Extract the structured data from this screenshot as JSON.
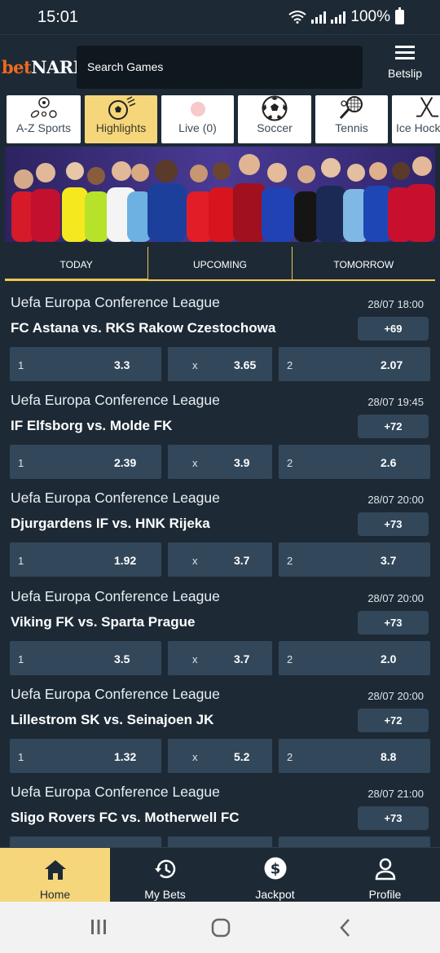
{
  "status": {
    "time": "15:01",
    "battery": "100%"
  },
  "header": {
    "logo_bet": "bet",
    "logo_nare": "NARE",
    "search_placeholder": "Search Games",
    "betslip_label": "Betslip"
  },
  "sports": [
    {
      "label": "A-Z Sports",
      "icon": "sports-balls-icon"
    },
    {
      "label": "Highlights",
      "icon": "soccer-ball-fast-icon"
    },
    {
      "label": "Live (0)",
      "icon": "live-dot-icon"
    },
    {
      "label": "Soccer",
      "icon": "soccer-ball-icon"
    },
    {
      "label": "Tennis",
      "icon": "tennis-racket-icon"
    },
    {
      "label": "Ice Hockey",
      "icon": "hockey-sticks-icon"
    }
  ],
  "tabs": [
    "TODAY",
    "UPCOMING",
    "TOMORROW"
  ],
  "matches": [
    {
      "league": "Uefa Europa Conference League",
      "time": "28/07 18:00",
      "teams": "FC Astana vs. RKS Rakow Czestochowa",
      "more": "+69",
      "odds": {
        "k1": "1",
        "v1": "3.3",
        "kx": "x",
        "vx": "3.65",
        "k2": "2",
        "v2": "2.07"
      }
    },
    {
      "league": "Uefa Europa Conference League",
      "time": "28/07 19:45",
      "teams": "IF Elfsborg vs. Molde FK",
      "more": "+72",
      "odds": {
        "k1": "1",
        "v1": "2.39",
        "kx": "x",
        "vx": "3.9",
        "k2": "2",
        "v2": "2.6"
      }
    },
    {
      "league": "Uefa Europa Conference League",
      "time": "28/07 20:00",
      "teams": "Djurgardens IF vs. HNK Rijeka",
      "more": "+73",
      "odds": {
        "k1": "1",
        "v1": "1.92",
        "kx": "x",
        "vx": "3.7",
        "k2": "2",
        "v2": "3.7"
      }
    },
    {
      "league": "Uefa Europa Conference League",
      "time": "28/07 20:00",
      "teams": "Viking FK vs. Sparta Prague",
      "more": "+73",
      "odds": {
        "k1": "1",
        "v1": "3.5",
        "kx": "x",
        "vx": "3.7",
        "k2": "2",
        "v2": "2.0"
      }
    },
    {
      "league": "Uefa Europa Conference League",
      "time": "28/07 20:00",
      "teams": "Lillestrom SK vs. Seinajoen JK",
      "more": "+72",
      "odds": {
        "k1": "1",
        "v1": "1.32",
        "kx": "x",
        "vx": "5.2",
        "k2": "2",
        "v2": "8.8"
      }
    },
    {
      "league": "Uefa Europa Conference League",
      "time": "28/07 21:00",
      "teams": "Sligo Rovers FC vs. Motherwell FC",
      "more": "+73",
      "odds": {
        "k1": "",
        "v1": "",
        "kx": "",
        "vx": "",
        "k2": "",
        "v2": ""
      }
    }
  ],
  "bottom_nav": [
    {
      "label": "Home",
      "icon": "home-icon"
    },
    {
      "label": "My Bets",
      "icon": "history-icon"
    },
    {
      "label": "Jackpot",
      "icon": "dollar-coin-icon"
    },
    {
      "label": "Profile",
      "icon": "person-icon"
    }
  ],
  "colors": {
    "background": "#1d2a36",
    "accent": "#f6d67a",
    "tab_underline": "#f0c64f",
    "odds_cell": "#33475a",
    "brand_orange": "#f06a1d"
  }
}
